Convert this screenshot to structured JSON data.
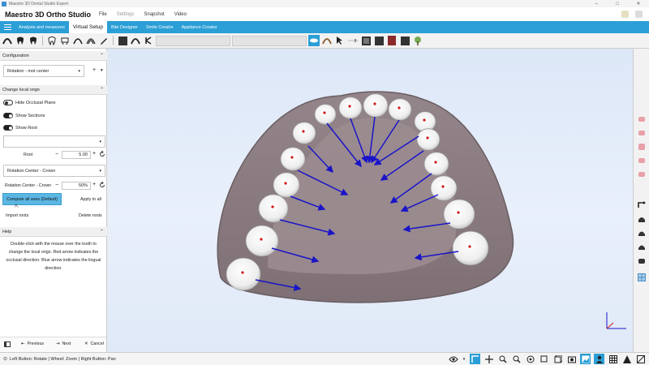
{
  "window": {
    "title": "Maestro 3D Dental Studio Expert",
    "controls": [
      "–",
      "□",
      "✕"
    ]
  },
  "menubar": {
    "app_title": "Maestro 3D Ortho Studio",
    "menus": [
      {
        "label": "File",
        "enabled": true
      },
      {
        "label": "Settings",
        "enabled": false
      },
      {
        "label": "Snapshot",
        "enabled": true
      },
      {
        "label": "Video",
        "enabled": true
      }
    ]
  },
  "tabs": [
    {
      "label": "Analysis and measures",
      "active": false
    },
    {
      "label": "Virtual Setup",
      "active": true
    },
    {
      "label": "Bite Designer",
      "active": false
    },
    {
      "label": "Smile Creator",
      "active": false
    },
    {
      "label": "Appliance Creator",
      "active": false
    }
  ],
  "left_panel": {
    "configuration": {
      "header": "Configuration",
      "select_value": "Rotation - mot center",
      "plus": "+",
      "more": "▾"
    },
    "local_origin": {
      "header": "Change local origo",
      "toggles": [
        {
          "label": "Hide Occlusal Plane",
          "on": false
        },
        {
          "label": "Show Sections",
          "on": true
        },
        {
          "label": "Show Root",
          "on": true
        }
      ],
      "empty_select": "",
      "root_label": "Root",
      "root_minus": "−",
      "root_value": "5.00",
      "root_plus": "+",
      "rotation_select": "Rotation Center - Crown",
      "rotation_label": "Rotation Center - Crown",
      "rotation_minus": "−",
      "rotation_value": "50%",
      "rotation_plus": "+",
      "compute_button": "Compute all axes (Default)",
      "apply_button": "Apply to all",
      "import_button": "Import roots",
      "delete_button": "Delete roots"
    },
    "help": {
      "header": "Help",
      "text_lines": [
        "Double-click with the mouse over the tooth to",
        "change the local origo. Red arrow indicates the",
        "occlusal direction. Blue arrow indicates the lingual",
        "direction."
      ]
    }
  },
  "navbar": {
    "previous": "Previous",
    "next": "Next",
    "cancel": "Cancel"
  },
  "statusbar": {
    "text": "Left Button: Rotate | Wheel: Zoom | Right Button: Pan"
  },
  "colors": {
    "accent": "#2b9fd6",
    "button_blue": "#5bb6e3",
    "arrow_blue": "#1a14c8",
    "arrow_red": "#d01818",
    "gum": "#8a7b80"
  }
}
